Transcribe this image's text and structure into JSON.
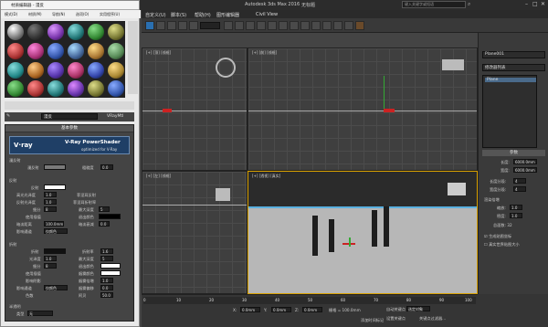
{
  "app": {
    "title": "Autodesk 3ds Max 2016",
    "doc": "无标题",
    "search_placeholder": "键入关键字或短语"
  },
  "menu": [
    "自定义(U)",
    "脚本(S)",
    "帮助(H)",
    "图形编辑器",
    "Civil View"
  ],
  "material_editor": {
    "title": "材质编辑器 - 漫反",
    "menus": [
      "模式(D)",
      "材质(M)",
      "导航(N)",
      "选项(O)",
      "实用程序(U)"
    ],
    "material_name": "漫反",
    "material_type": "VRayMtl",
    "rollout_basic": "基本参数",
    "banner_brand": "V·ray",
    "banner_title": "V-Ray PowerShader",
    "banner_sub": "optimized for V-Ray",
    "sec_diffuse": "漫反射",
    "diffuse_label": "漫反射",
    "roughness_label": "粗糙度",
    "roughness_value": "0.0",
    "sec_reflect": "反射",
    "reflect_label": "反射",
    "hilight_gloss": "高光光泽度",
    "hilight_value": "1.0",
    "refl_gloss": "反射光泽度",
    "refl_value": "1.0",
    "subdivs": "细分",
    "subdivs_value": "8",
    "use_interp": "使用插值",
    "dim_dist": "暗淡距离",
    "dim_value": "100.0mm",
    "affect_ch": "影响通道",
    "affect_value": "仅颜色",
    "fresnel": "菲涅耳反射",
    "fresnel_ior": "菲涅耳折射率",
    "max_depth": "最大深度",
    "max_depth_value": "5",
    "exit_color": "退出颜色",
    "dim_falloff": "暗淡衰减",
    "dim_falloff_value": "0.0",
    "sec_refract": "折射",
    "refract_label": "折射",
    "ior_label": "折射率",
    "ior_value": "1.6",
    "gloss_label": "光泽度",
    "gloss_value": "1.0",
    "r_max_depth": "最大深度",
    "r_max_value": "5",
    "r_subdivs": "细分",
    "r_subdivs_value": "8",
    "r_exit": "退出颜色",
    "r_use_interp": "使用插值",
    "fog_color": "烟雾颜色",
    "affect_shadow": "影响阴影",
    "fog_mult": "烟雾倍增",
    "fog_mult_value": "1.0",
    "r_affect_ch": "影响通道",
    "r_affect_value": "仅颜色",
    "fog_bias": "烟雾偏移",
    "fog_bias_value": "0.0",
    "dispersion": "色散",
    "abbe": "阿贝",
    "abbe_value": "50.0",
    "sec_translucent": "半透明",
    "type_label": "类型",
    "type_value": "无"
  },
  "viewports": {
    "top": "[+] [顶] [线框]",
    "front": "[+] [前] [线框]",
    "left": "[+] [左] [线框]",
    "persp": "[+] [透视] [真实]"
  },
  "command_panel": {
    "object_name": "Plane001",
    "modifier_list": "修改器列表",
    "stack_item": "Plane",
    "rollout_params": "参数",
    "length_label": "长度:",
    "length_value": "6000.0mm",
    "width_label": "宽度:",
    "width_value": "6000.0mm",
    "lsegs_label": "长度分段:",
    "lsegs_value": "4",
    "wsegs_label": "宽度分段:",
    "wsegs_value": "4",
    "render_mult": "渲染倍增",
    "scale_label": "缩放:",
    "scale_value": "1.0",
    "density_label": "密度:",
    "density_value": "1.0",
    "total_faces": "总面数: 32",
    "gen_uv": "生成贴图坐标",
    "real_world": "真实世界贴图大小"
  },
  "timeline": {
    "ticks": [
      "0",
      "10",
      "20",
      "30",
      "40",
      "50",
      "60",
      "70",
      "80",
      "90",
      "100"
    ],
    "x_label": "X:",
    "x_value": "0.0mm",
    "y_label": "Y:",
    "y_value": "0.0mm",
    "z_label": "Z:",
    "z_value": "0.0mm",
    "grid": "栅格 = 100.0mm",
    "auto_key": "自动关键点",
    "selected": "选定对象",
    "set_key": "设置关键点",
    "key_filter": "关键点过滤器...",
    "add_time": "添加时间标记"
  }
}
